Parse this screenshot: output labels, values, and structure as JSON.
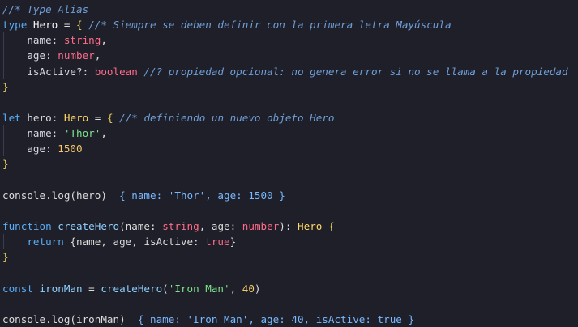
{
  "editor": {
    "lines": [
      {
        "guide": false,
        "segments": [
          {
            "t": "//* Type Alias",
            "c": "comment"
          }
        ]
      },
      {
        "guide": false,
        "segments": [
          {
            "t": "type ",
            "c": "keyword"
          },
          {
            "t": "Hero",
            "c": "type"
          },
          {
            "t": " = ",
            "c": "plain"
          },
          {
            "t": "{",
            "c": "brace"
          },
          {
            "t": " //* Siempre se deben definir con la primera letra Mayúscula",
            "c": "comment"
          }
        ]
      },
      {
        "guide": true,
        "segments": [
          {
            "t": "    name",
            "c": "prop"
          },
          {
            "t": ": ",
            "c": "plain"
          },
          {
            "t": "string",
            "c": "bool"
          },
          {
            "t": ",",
            "c": "plain"
          }
        ]
      },
      {
        "guide": true,
        "segments": [
          {
            "t": "    age",
            "c": "prop"
          },
          {
            "t": ": ",
            "c": "plain"
          },
          {
            "t": "number",
            "c": "bool"
          },
          {
            "t": ",",
            "c": "plain"
          }
        ]
      },
      {
        "guide": true,
        "segments": [
          {
            "t": "    isActive?",
            "c": "prop"
          },
          {
            "t": ": ",
            "c": "plain"
          },
          {
            "t": "boolean",
            "c": "bool"
          },
          {
            "t": " //? propiedad opcional: no genera error si no se llama a la propiedad",
            "c": "comment"
          }
        ]
      },
      {
        "guide": false,
        "segments": [
          {
            "t": "}",
            "c": "brace"
          }
        ]
      },
      {
        "guide": false,
        "segments": [
          {
            "t": "",
            "c": "plain"
          }
        ]
      },
      {
        "guide": false,
        "segments": [
          {
            "t": "let ",
            "c": "keyword"
          },
          {
            "t": "hero",
            "c": "plain"
          },
          {
            "t": ": ",
            "c": "plain"
          },
          {
            "t": "Hero",
            "c": "yellow"
          },
          {
            "t": " = ",
            "c": "plain"
          },
          {
            "t": "{",
            "c": "brace"
          },
          {
            "t": " //* definiendo un nuevo objeto Hero",
            "c": "comment"
          }
        ]
      },
      {
        "guide": true,
        "segments": [
          {
            "t": "    name",
            "c": "prop"
          },
          {
            "t": ": ",
            "c": "plain"
          },
          {
            "t": "'Thor'",
            "c": "string"
          },
          {
            "t": ",",
            "c": "plain"
          }
        ]
      },
      {
        "guide": true,
        "segments": [
          {
            "t": "    age",
            "c": "prop"
          },
          {
            "t": ": ",
            "c": "plain"
          },
          {
            "t": "1500",
            "c": "number"
          }
        ]
      },
      {
        "guide": false,
        "segments": [
          {
            "t": "}",
            "c": "brace"
          }
        ]
      },
      {
        "guide": false,
        "segments": [
          {
            "t": "",
            "c": "plain"
          }
        ]
      },
      {
        "guide": false,
        "segments": [
          {
            "t": "console",
            "c": "plain"
          },
          {
            "t": ".",
            "c": "plain"
          },
          {
            "t": "log",
            "c": "plain"
          },
          {
            "t": "(hero)",
            "c": "plain"
          },
          {
            "t": "  { name: 'Thor', age: 1500 }",
            "c": "hint"
          }
        ]
      },
      {
        "guide": false,
        "segments": [
          {
            "t": "",
            "c": "plain"
          }
        ]
      },
      {
        "guide": false,
        "segments": [
          {
            "t": "function ",
            "c": "keyword"
          },
          {
            "t": "createHero",
            "c": "func"
          },
          {
            "t": "(",
            "c": "plain"
          },
          {
            "t": "name",
            "c": "plain"
          },
          {
            "t": ": ",
            "c": "plain"
          },
          {
            "t": "string",
            "c": "bool"
          },
          {
            "t": ", ",
            "c": "plain"
          },
          {
            "t": "age",
            "c": "plain"
          },
          {
            "t": ": ",
            "c": "plain"
          },
          {
            "t": "number",
            "c": "bool"
          },
          {
            "t": "): ",
            "c": "plain"
          },
          {
            "t": "Hero",
            "c": "yellow"
          },
          {
            "t": " {",
            "c": "brace"
          }
        ]
      },
      {
        "guide": true,
        "segments": [
          {
            "t": "    return ",
            "c": "keyword"
          },
          {
            "t": "{",
            "c": "plain"
          },
          {
            "t": "name, age, isActive: ",
            "c": "plain"
          },
          {
            "t": "true",
            "c": "bool"
          },
          {
            "t": "}",
            "c": "plain"
          }
        ]
      },
      {
        "guide": false,
        "segments": [
          {
            "t": "}",
            "c": "brace"
          }
        ]
      },
      {
        "guide": false,
        "segments": [
          {
            "t": "",
            "c": "plain"
          }
        ]
      },
      {
        "guide": false,
        "segments": [
          {
            "t": "const ",
            "c": "keyword"
          },
          {
            "t": "ironMan",
            "c": "func"
          },
          {
            "t": " = ",
            "c": "plain"
          },
          {
            "t": "createHero",
            "c": "func"
          },
          {
            "t": "(",
            "c": "plain"
          },
          {
            "t": "'Iron Man'",
            "c": "string"
          },
          {
            "t": ", ",
            "c": "plain"
          },
          {
            "t": "40",
            "c": "number"
          },
          {
            "t": ")",
            "c": "plain"
          }
        ]
      },
      {
        "guide": false,
        "segments": [
          {
            "t": "",
            "c": "plain"
          }
        ]
      },
      {
        "guide": false,
        "segments": [
          {
            "t": "console",
            "c": "plain"
          },
          {
            "t": ".",
            "c": "plain"
          },
          {
            "t": "log",
            "c": "plain"
          },
          {
            "t": "(ironMan)",
            "c": "plain"
          },
          {
            "t": "  { name: 'Iron Man', age: 40, isActive: true }",
            "c": "hint"
          }
        ]
      }
    ]
  }
}
